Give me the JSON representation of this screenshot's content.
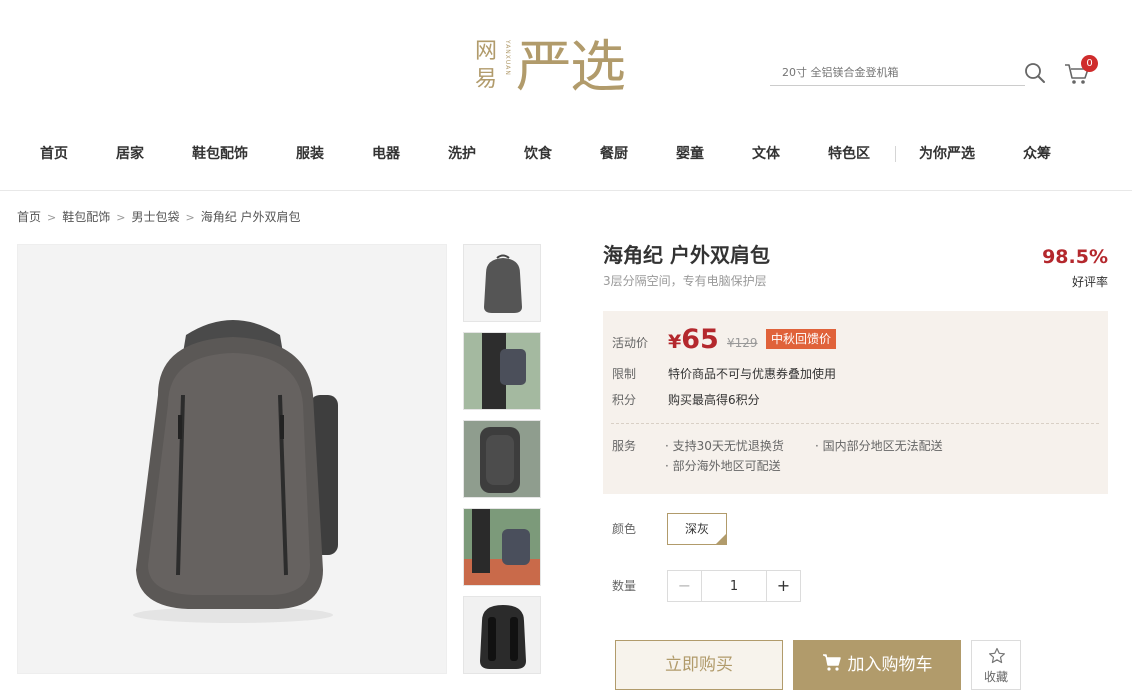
{
  "brand": {
    "logo_small": "网易",
    "logo_latin": "YANXUAN",
    "logo_main": "严选",
    "accent_color": "#b19b6b",
    "price_color": "#b4282d"
  },
  "header": {
    "search_placeholder": "20寸 全铝镁合金登机箱",
    "cart_count": "0"
  },
  "nav": [
    {
      "label": "首页"
    },
    {
      "label": "居家"
    },
    {
      "label": "鞋包配饰"
    },
    {
      "label": "服装"
    },
    {
      "label": "电器"
    },
    {
      "label": "洗护"
    },
    {
      "label": "饮食"
    },
    {
      "label": "餐厨"
    },
    {
      "label": "婴童"
    },
    {
      "label": "文体"
    },
    {
      "label": "特色区"
    },
    {
      "label": "为你严选"
    },
    {
      "label": "众筹"
    }
  ],
  "breadcrumb": [
    "首页",
    "鞋包配饰",
    "男士包袋",
    "海角纪 户外双肩包"
  ],
  "product": {
    "title": "海角纪 户外双肩包",
    "subtitle": "3层分隔空间，专有电脑保护层",
    "rating": "98.5%",
    "rating_label": "好评率",
    "price_label": "活动价",
    "price_symbol": "¥",
    "price": "65",
    "original_price": "¥129",
    "promo_badge": "中秋回馈价",
    "limit_label": "限制",
    "limit_text": "特价商品不可与优惠券叠加使用",
    "points_label": "积分",
    "points_text": "购买最高得6积分",
    "service_label": "服务",
    "services": [
      "支持30天无忧退换货",
      "国内部分地区无法配送",
      "部分海外地区可配送"
    ],
    "color_label": "颜色",
    "color_option": "深灰",
    "qty_label": "数量",
    "qty_value": "1",
    "qty_minus": "−",
    "qty_plus": "+",
    "buy_now": "立即购买",
    "add_to_cart": "加入购物车",
    "favorite": "收藏"
  }
}
